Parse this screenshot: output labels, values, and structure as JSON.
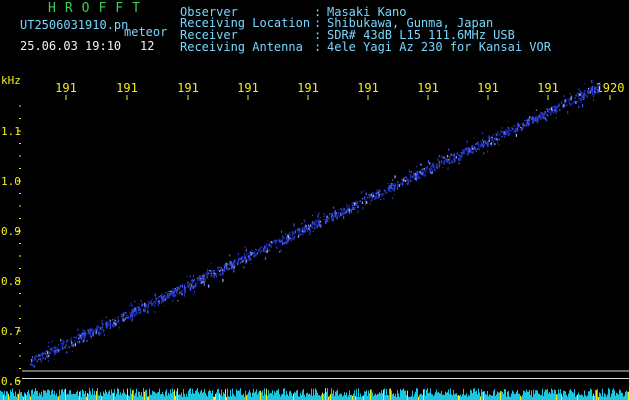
{
  "header": {
    "app_title": "HROFFT",
    "filename": "UT2506031910.pn",
    "mode": "meteor",
    "datetime": "25.06.03 19:10",
    "count": "12",
    "info_rows": [
      {
        "label": "Observer",
        "sep": ":",
        "value": "Masaki Kano"
      },
      {
        "label": "Receiving Location",
        "sep": ":",
        "value": "Shibukawa, Gunma, Japan"
      },
      {
        "label": "Receiver",
        "sep": ":",
        "value": "SDR# 43dB L15 111.6MHz USB"
      },
      {
        "label": "Receiving Antenna",
        "sep": ":",
        "value": "4ele Yagi Az 230 for Kansai VOR"
      }
    ]
  },
  "colors": {
    "title_green": "#33d15a",
    "info_cyan": "#77d7ff",
    "time_yellow": "#f4ef1a",
    "signal_blue": "#3f55ff",
    "noise_cyan": "#19c7e0"
  },
  "chart_data": {
    "type": "spectrogram",
    "ylabel": "kHz",
    "time_ticks": [
      "191",
      "191",
      "191",
      "191",
      "191",
      "191",
      "191",
      "191",
      "191",
      "1920"
    ],
    "freq_ticks": [
      "1.1",
      "1.0",
      "0.9",
      "0.8",
      "0.7",
      "0.6"
    ],
    "ylim": [
      0.6,
      1.15
    ],
    "baseline_lines_khz": [
      0.62,
      0.605
    ],
    "signal_trace": {
      "start_khz": 0.64,
      "end_khz": 1.19,
      "shape": "linear drift"
    }
  }
}
